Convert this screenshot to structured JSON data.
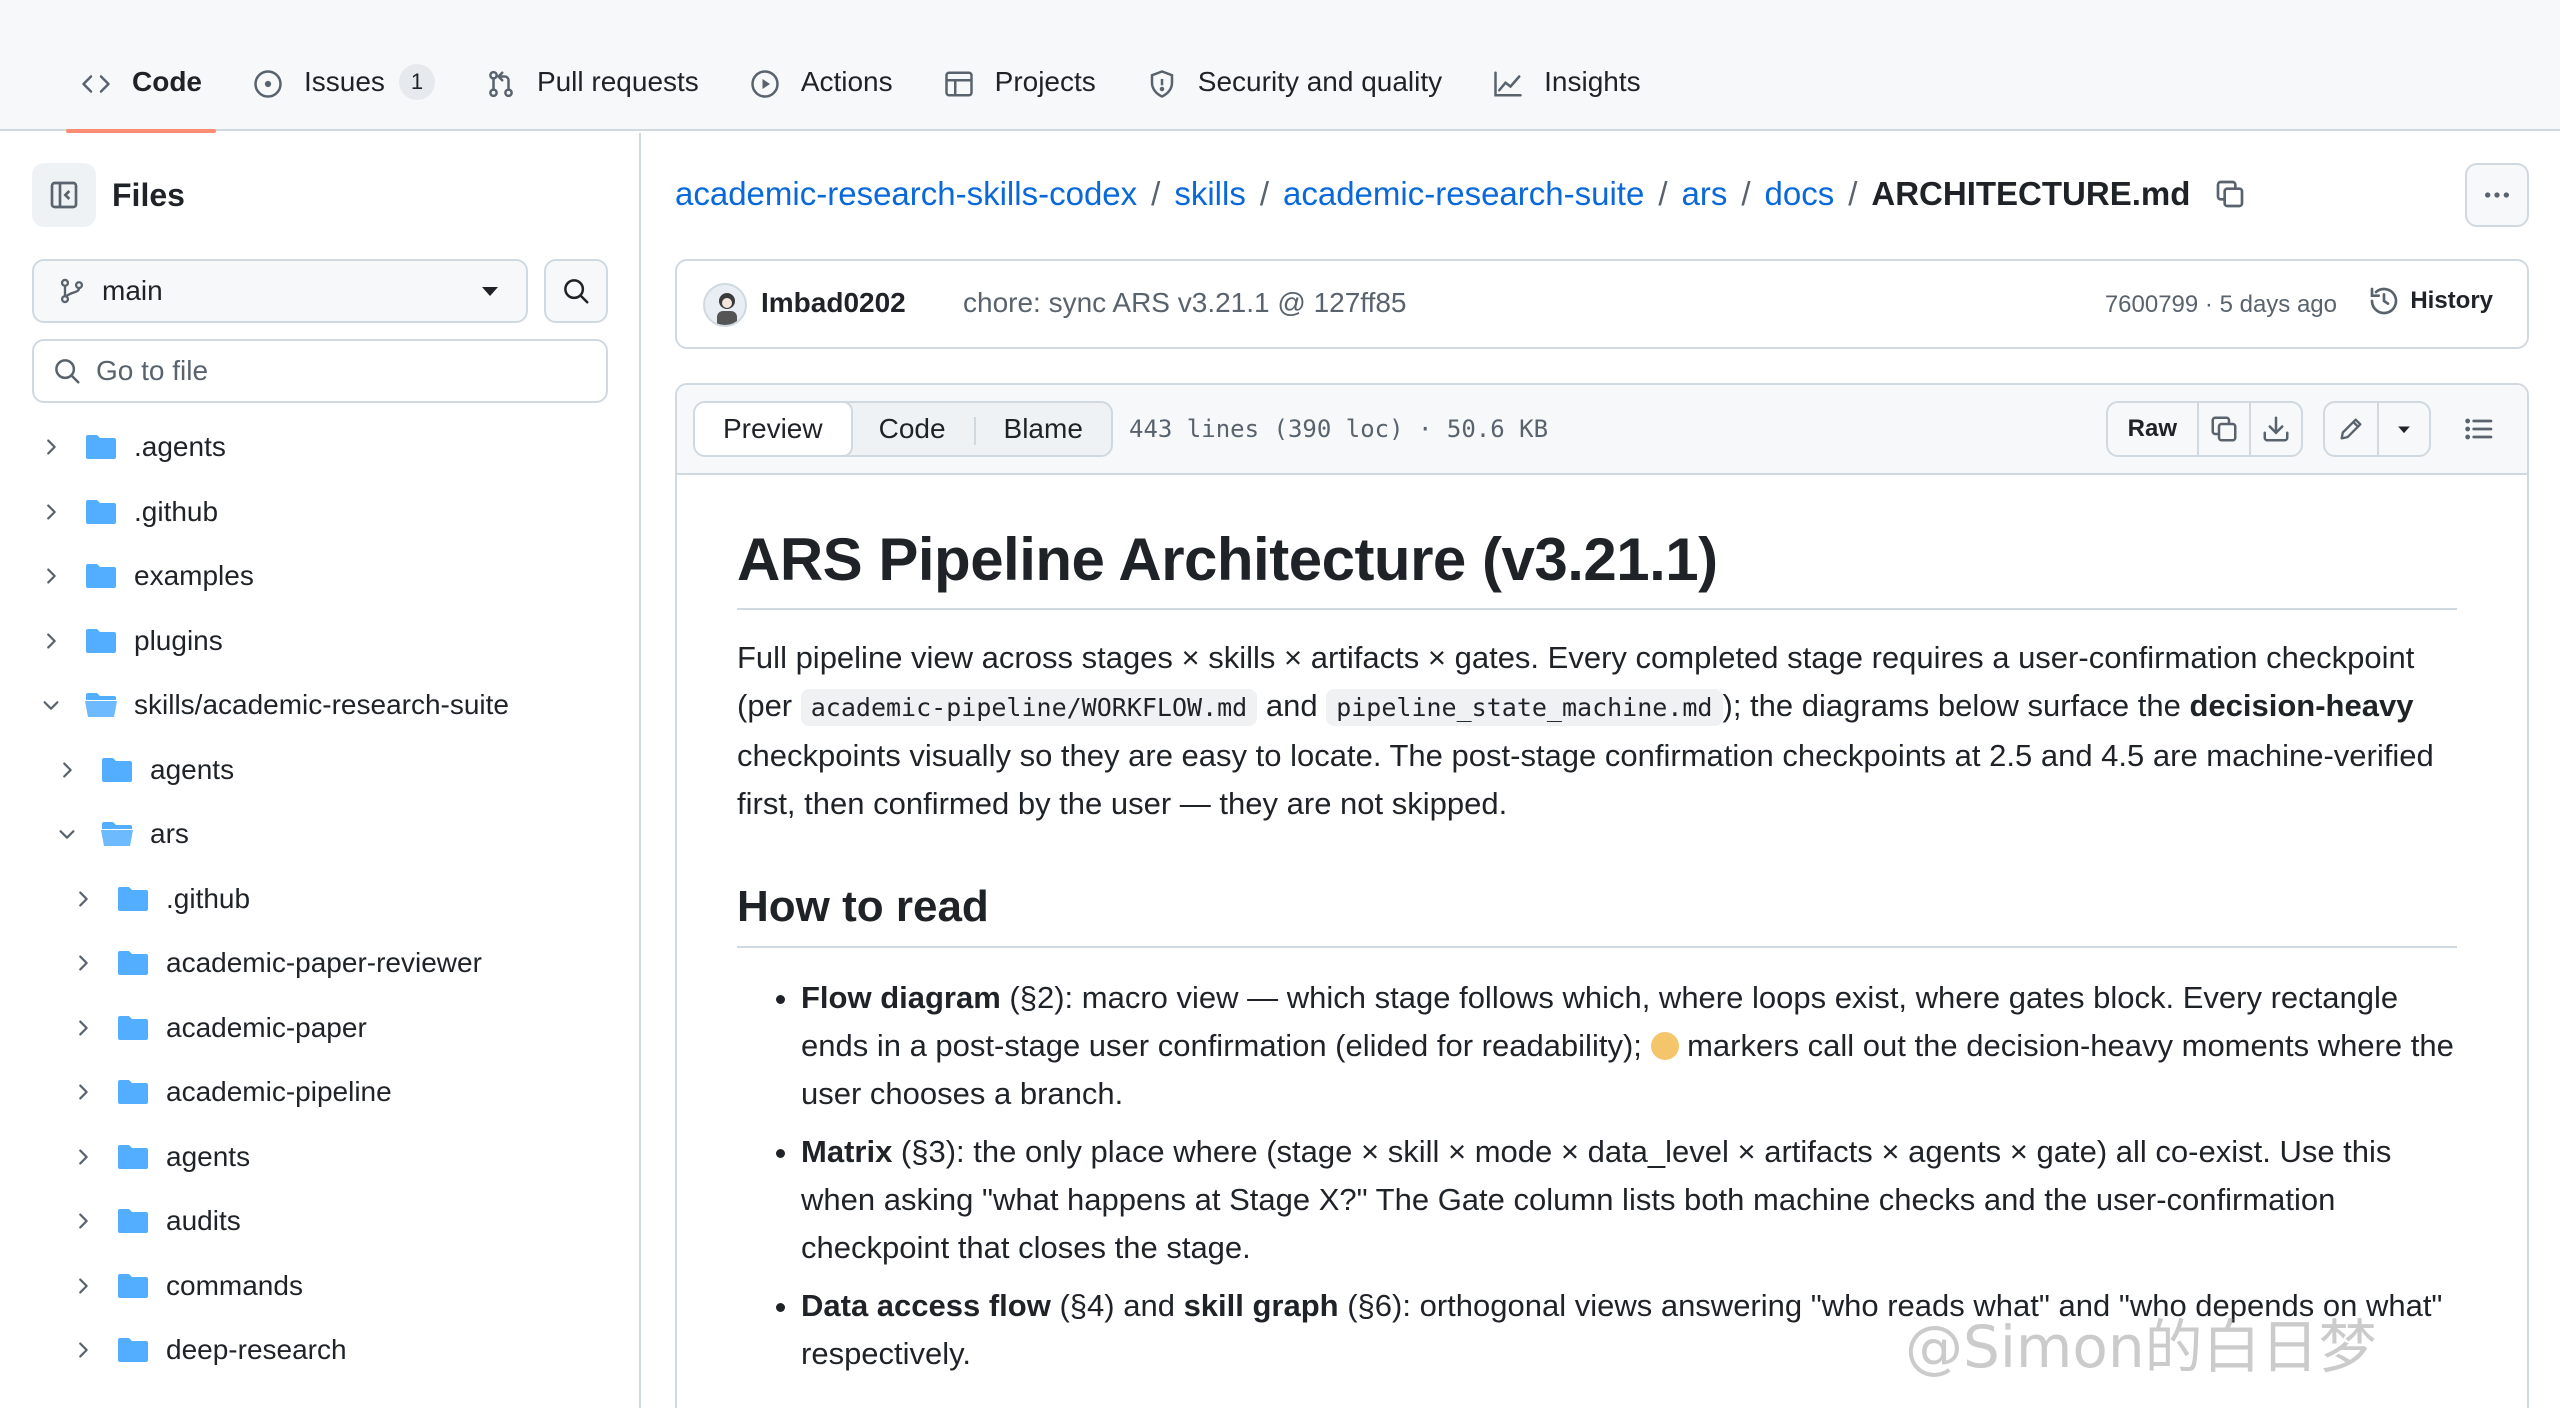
{
  "nav": {
    "tabs": [
      {
        "label": "Code",
        "icon": "code-icon",
        "active": true
      },
      {
        "label": "Issues",
        "icon": "issue-opened-icon",
        "count": "1"
      },
      {
        "label": "Pull requests",
        "icon": "git-pull-request-icon"
      },
      {
        "label": "Actions",
        "icon": "play-icon"
      },
      {
        "label": "Projects",
        "icon": "table-icon"
      },
      {
        "label": "Security and quality",
        "icon": "shield-icon"
      },
      {
        "label": "Insights",
        "icon": "graph-icon"
      }
    ]
  },
  "sidebar": {
    "title": "Files",
    "branch": "main",
    "goto_placeholder": "Go to file",
    "tree": [
      {
        "name": ".agents",
        "depth": 0,
        "open": false
      },
      {
        "name": ".github",
        "depth": 0,
        "open": false
      },
      {
        "name": "examples",
        "depth": 0,
        "open": false
      },
      {
        "name": "plugins",
        "depth": 0,
        "open": false
      },
      {
        "name": "skills/academic-research-suite",
        "depth": 0,
        "open": true
      },
      {
        "name": "agents",
        "depth": 1,
        "open": false
      },
      {
        "name": "ars",
        "depth": 1,
        "open": true
      },
      {
        "name": ".github",
        "depth": 2,
        "open": false
      },
      {
        "name": "academic-paper-reviewer",
        "depth": 2,
        "open": false
      },
      {
        "name": "academic-paper",
        "depth": 2,
        "open": false
      },
      {
        "name": "academic-pipeline",
        "depth": 2,
        "open": false
      },
      {
        "name": "agents",
        "depth": 2,
        "open": false
      },
      {
        "name": "audits",
        "depth": 2,
        "open": false
      },
      {
        "name": "commands",
        "depth": 2,
        "open": false
      },
      {
        "name": "deep-research",
        "depth": 2,
        "open": false
      }
    ]
  },
  "breadcrumb": {
    "parts": [
      "academic-research-skills-codex",
      "skills",
      "academic-research-suite",
      "ars",
      "docs"
    ],
    "current": "ARCHITECTURE.md"
  },
  "commit": {
    "author": "Imbad0202",
    "message": "chore: sync ARS v3.21.1 @ 127ff85",
    "meta": "7600799 · 5 days ago",
    "history_label": "History"
  },
  "file": {
    "views": [
      "Preview",
      "Code",
      "Blame"
    ],
    "info": "443 lines (390 loc) · 50.6 KB",
    "raw_label": "Raw"
  },
  "doc": {
    "h1": "ARS Pipeline Architecture (v3.21.1)",
    "p1": {
      "a": "Full pipeline view across stages × skills × artifacts × gates. Every completed stage requires a user-confirmation checkpoint (per ",
      "code1": "academic-pipeline/WORKFLOW.md",
      "b": " and ",
      "code2": "pipeline_state_machine.md",
      "c": "); the diagrams below surface the ",
      "bold": "decision-heavy",
      "d": " checkpoints visually so they are easy to locate. The post-stage confirmation checkpoints at 2.5 and 4.5 are machine-verified first, then confirmed by the user — they are not skipped."
    },
    "h2": "How to read",
    "items": [
      {
        "bold": "Flow diagram",
        "a": " (§2): macro view — which stage follows which, where loops exist, where gates block. Every rectangle ends in a post-stage user confirmation (elided for readability); ",
        "b": " markers call out the decision-heavy moments where the user chooses a branch."
      },
      {
        "bold": "Matrix",
        "a": " (§3): the only place where (stage × skill × mode × data_level × artifacts × agents × gate) all co-exist. Use this when asking \"what happens at Stage X?\" The Gate column lists both machine checks and the user-confirmation checkpoint that closes the stage."
      },
      {
        "bold": "Data access flow",
        "a": " (§4) and ",
        "bold2": "skill graph",
        "b": " (§6): orthogonal views answering \"who reads what\" and \"who depends on what\" respectively."
      }
    ]
  },
  "watermark": "@Simon的白日梦"
}
